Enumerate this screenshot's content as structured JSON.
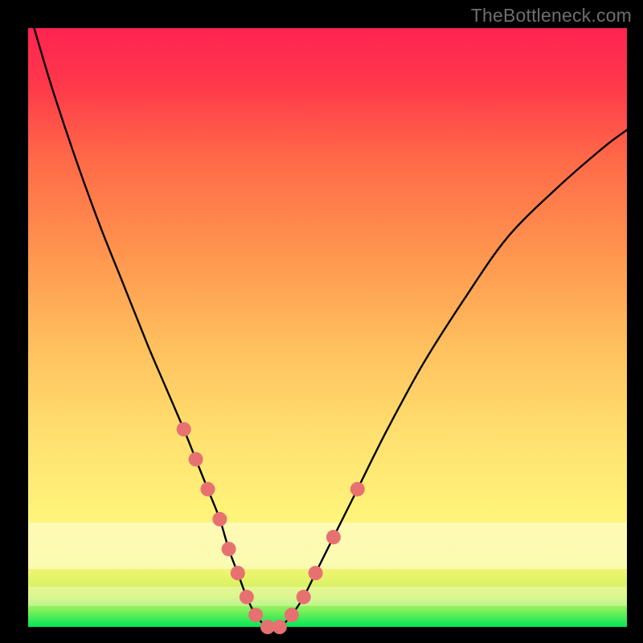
{
  "watermark": "TheBottleneck.com",
  "colors": {
    "frame": "#000000",
    "curve": "#000000",
    "marker": "#e77171",
    "grad_top": "#ff2352",
    "grad_bottom": "#00e756"
  },
  "chart_data": {
    "type": "line",
    "title": "",
    "xlabel": "",
    "ylabel": "",
    "xlim": [
      0,
      100
    ],
    "ylim": [
      0,
      100
    ],
    "series": [
      {
        "name": "bottleneck-curve",
        "x": [
          1,
          4,
          8,
          12,
          16,
          20,
          23,
          26,
          28,
          30,
          32,
          33.5,
          35,
          36.5,
          38,
          40,
          42,
          44,
          46,
          48,
          51,
          55,
          60,
          66,
          73,
          80,
          88,
          96,
          100
        ],
        "y": [
          100,
          90,
          78,
          67,
          57,
          47,
          40,
          33,
          28,
          23,
          18,
          13,
          9,
          5,
          2,
          0,
          0,
          2,
          5,
          9,
          15,
          23,
          33,
          44,
          55,
          65,
          73,
          80,
          83
        ]
      }
    ],
    "markers": {
      "name": "highlighted-points",
      "x": [
        26,
        28,
        30,
        32,
        33.5,
        35,
        36.5,
        38,
        40,
        42,
        44,
        46,
        48,
        51,
        55
      ],
      "y": [
        33,
        28,
        23,
        18,
        13,
        9,
        5,
        2,
        0,
        0,
        2,
        5,
        9,
        15,
        23
      ]
    }
  }
}
